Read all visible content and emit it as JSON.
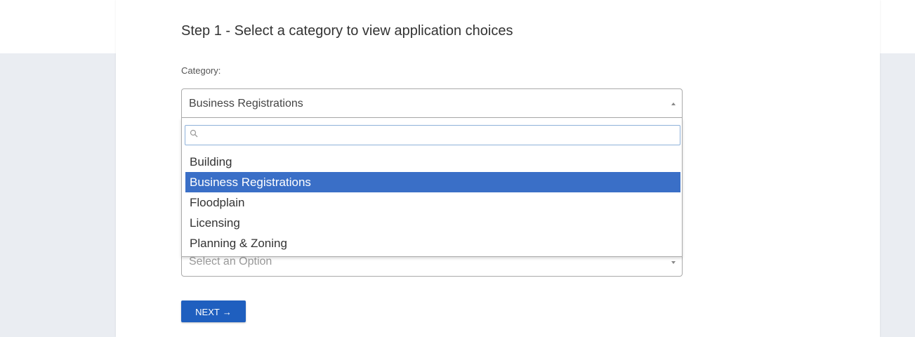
{
  "step": {
    "title": "Step 1 - Select a category to view application choices"
  },
  "category": {
    "label": "Category:",
    "selected_value": "Business Registrations",
    "search_value": "",
    "options": [
      "Building",
      "Business Registrations",
      "Floodplain",
      "Licensing",
      "Planning & Zoning"
    ],
    "highlighted_option": "Business Registrations"
  },
  "application": {
    "placeholder": "Select an Option"
  },
  "actions": {
    "next_label": "NEXT",
    "next_icon": "→",
    "next_icon_name": "arrow-right-icon"
  },
  "colors": {
    "highlight": "#3a6fc7",
    "button": "#1f5fbf",
    "background": "#eaedf2"
  }
}
